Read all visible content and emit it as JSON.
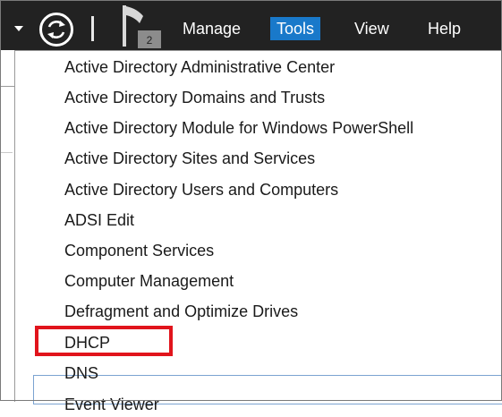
{
  "menubar": {
    "badge_count": "2",
    "menu_items": [
      {
        "label": "Manage",
        "active": false
      },
      {
        "label": "Tools",
        "active": true
      },
      {
        "label": "View",
        "active": false
      },
      {
        "label": "Help",
        "active": false
      }
    ],
    "icons": [
      "chevron-down-icon",
      "refresh-icon",
      "notification-flag-icon"
    ],
    "colors": {
      "bar_bg": "#222222",
      "active_menu": "#1979ca"
    }
  },
  "tools_menu": {
    "items": [
      "Active Directory Administrative Center",
      "Active Directory Domains and Trusts",
      "Active Directory Module for Windows PowerShell",
      "Active Directory Sites and Services",
      "Active Directory Users and Computers",
      "ADSI Edit",
      "Component Services",
      "Computer Management",
      "Defragment and Optimize Drives",
      "DHCP",
      "DNS",
      "Event Viewer"
    ],
    "hovered_item": "DHCP",
    "annotation_color": "#e1141c"
  }
}
